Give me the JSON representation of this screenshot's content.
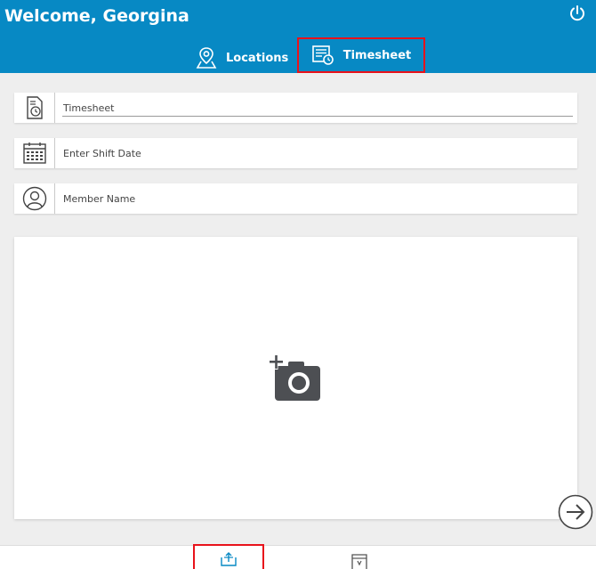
{
  "header": {
    "welcome": "Welcome, Georgina",
    "power_icon": "power-icon"
  },
  "tabs": [
    {
      "label": "Locations",
      "icon": "map-pin-icon",
      "selected": false
    },
    {
      "label": "Timesheet",
      "icon": "timesheet-icon",
      "selected": true
    }
  ],
  "form": {
    "timesheet_label": "Timesheet",
    "shift_date_placeholder": "Enter Shift Date",
    "member_name_placeholder": "Member Name"
  },
  "photo": {
    "icon": "add-camera-icon"
  },
  "next_icon": "arrow-right-circle-icon",
  "bottom_nav": [
    {
      "icon": "upload-icon",
      "selected": true
    },
    {
      "icon": "document-icon",
      "selected": false
    }
  ],
  "colors": {
    "header": "#0789c4",
    "highlight": "#e8121b",
    "background": "#eeeeee"
  }
}
